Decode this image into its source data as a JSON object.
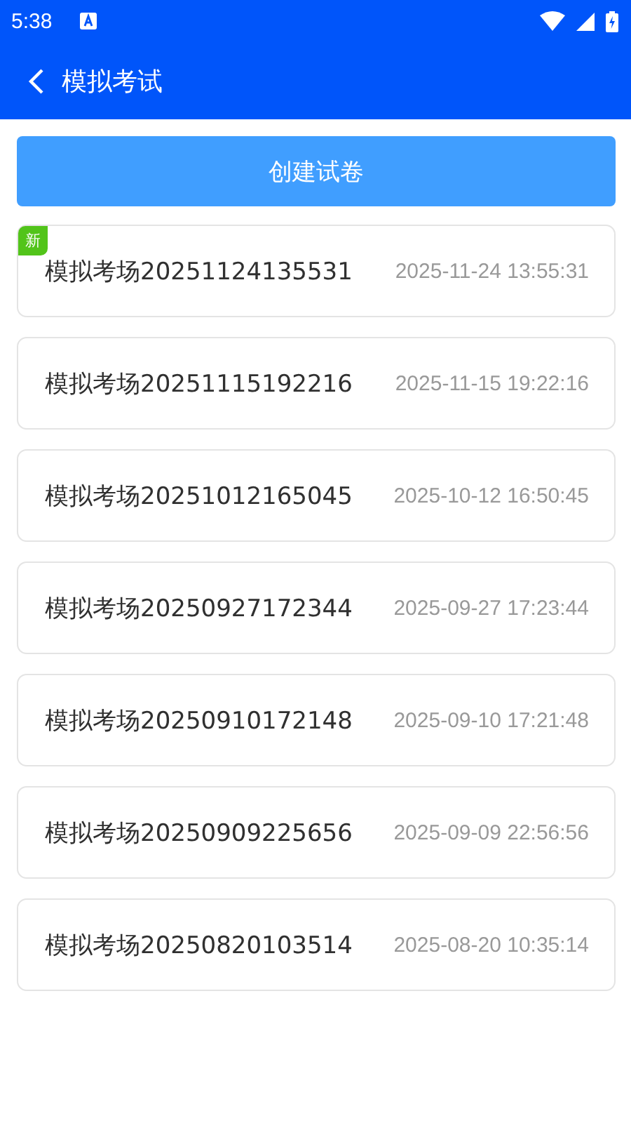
{
  "status_bar": {
    "time": "5:38"
  },
  "header": {
    "title": "模拟考试"
  },
  "create_button": "创建试卷",
  "exams": [
    {
      "name": "模拟考场20251124135531",
      "time": "2025-11-24 13:55:31",
      "badge": "新"
    },
    {
      "name": "模拟考场20251115192216",
      "time": "2025-11-15 19:22:16"
    },
    {
      "name": "模拟考场20251012165045",
      "time": "2025-10-12 16:50:45"
    },
    {
      "name": "模拟考场20250927172344",
      "time": "2025-09-27 17:23:44"
    },
    {
      "name": "模拟考场20250910172148",
      "time": "2025-09-10 17:21:48"
    },
    {
      "name": "模拟考场20250909225656",
      "time": "2025-09-09 22:56:56"
    },
    {
      "name": "模拟考场20250820103514",
      "time": "2025-08-20 10:35:14"
    }
  ]
}
